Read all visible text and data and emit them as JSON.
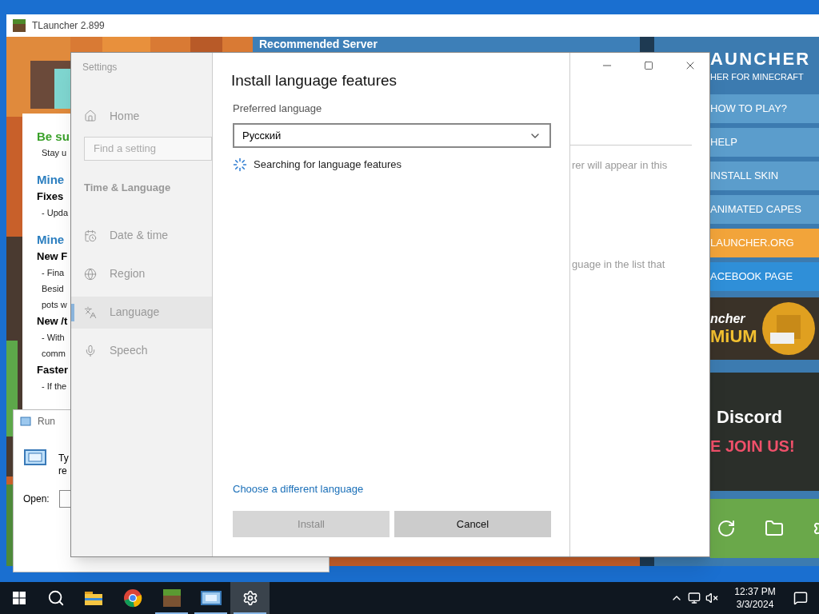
{
  "tlauncher": {
    "title": "TLauncher 2.899",
    "banner_title": "Recommended Server",
    "news": [
      {
        "kind": "heading",
        "text": "Be su"
      },
      {
        "kind": "line",
        "text": "Stay u"
      },
      {
        "kind": "title",
        "text": "Mine"
      },
      {
        "kind": "subtitle",
        "text": "Fixes"
      },
      {
        "kind": "line",
        "text": "- Upda"
      },
      {
        "kind": "title",
        "text": "Mine"
      },
      {
        "kind": "subtitle",
        "text": "New F"
      },
      {
        "kind": "line",
        "text": "- Fina"
      },
      {
        "kind": "line",
        "text": "Besid"
      },
      {
        "kind": "line",
        "text": "pots w"
      },
      {
        "kind": "subtitle",
        "text": "New /t"
      },
      {
        "kind": "line",
        "text": "- With"
      },
      {
        "kind": "line",
        "text": "comm"
      },
      {
        "kind": "subtitle",
        "text": "Faster"
      },
      {
        "kind": "line",
        "text": "- If the"
      }
    ],
    "brand": {
      "name": "AUNCHER",
      "tagline": "HER FOR MINECRAFT"
    },
    "menu": [
      {
        "label": "HOW TO PLAY?",
        "color": "#5b9dcc"
      },
      {
        "label": "HELP",
        "color": "#5b9dcc"
      },
      {
        "label": "INSTALL SKIN",
        "color": "#5b9dcc"
      },
      {
        "label": "ANIMATED CAPES",
        "color": "#5b9dcc"
      },
      {
        "label": "LAUNCHER.ORG",
        "color": "#f2a43a"
      },
      {
        "label": "ACEBOOK PAGE",
        "color": "#2f8fd8"
      }
    ],
    "banners": [
      {
        "kind": "premium",
        "lines": [
          "ncher",
          "MiUM"
        ]
      },
      {
        "kind": "discord",
        "lines": [
          "Discord",
          "E JOIN US!"
        ]
      }
    ]
  },
  "run_dialog": {
    "title": "Run",
    "text_lines": [
      "Ty",
      "re"
    ],
    "open_label": "Open:"
  },
  "settings": {
    "app_title": "Settings",
    "search": {
      "placeholder": "Find a setting"
    },
    "section": "Time & Language",
    "nav": [
      {
        "kind": "home",
        "label": "Home",
        "selected": false
      },
      {
        "kind": "date",
        "label": "Date & time",
        "selected": false
      },
      {
        "kind": "region",
        "label": "Region",
        "selected": false
      },
      {
        "kind": "language",
        "label": "Language",
        "selected": true
      },
      {
        "kind": "speech",
        "label": "Speech",
        "selected": false
      }
    ],
    "dialog": {
      "title": "Install language features",
      "field_label": "Preferred language",
      "dropdown_value": "Русский",
      "status": "Searching for language features",
      "link": "Choose a different language",
      "buttons": [
        {
          "label": "Install",
          "disabled": true
        },
        {
          "label": "Cancel",
          "disabled": false
        }
      ]
    },
    "background_texts": [
      "rer will appear in this",
      "guage in the list that"
    ]
  },
  "taskbar": {
    "apps": [
      {
        "kind": "explorer",
        "running": false,
        "selected": false
      },
      {
        "kind": "chrome",
        "running": false,
        "selected": false
      },
      {
        "kind": "minecraft",
        "running": true,
        "selected": false
      },
      {
        "kind": "run",
        "running": true,
        "selected": false
      },
      {
        "kind": "settings",
        "running": true,
        "selected": true
      }
    ],
    "time": "12:37 PM",
    "date": "3/3/2024"
  }
}
